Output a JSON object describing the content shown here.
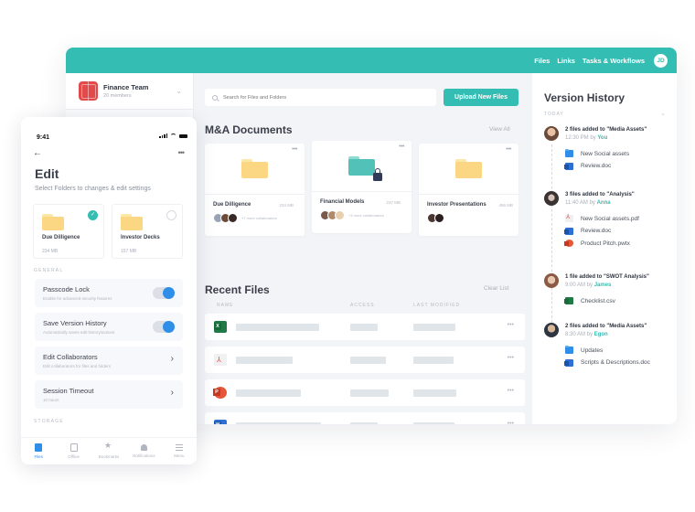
{
  "desktop": {
    "topnav": {
      "links": [
        "Files",
        "Links",
        "Tasks & Workflows"
      ],
      "user_initials": "JD"
    },
    "team": {
      "name": "Finance Team",
      "members": "20 members"
    },
    "search": {
      "placeholder": "Search for Files and Folders",
      "value": ""
    },
    "upload_button": "Upload New Files",
    "ma_documents": {
      "title": "M&A Documents",
      "view_all": "View All",
      "folders": [
        {
          "name": "Due Dilligence",
          "size": "234 MB",
          "collaborators_more": "+7 more collaborators",
          "locked": false,
          "color": "#fcd783"
        },
        {
          "name": "Financial Models",
          "size": "237 MB",
          "collaborators_more": "+4 more collaborators",
          "locked": true,
          "color": "#52c2b8"
        },
        {
          "name": "Investor Presentations",
          "size": "456 MB",
          "collaborators_more": "",
          "locked": false,
          "color": "#fcd783"
        }
      ]
    },
    "recent_files": {
      "title": "Recent Files",
      "clear_list": "Clear List",
      "columns": [
        "NAME",
        "ACCESS",
        "LAST MODIFIED"
      ],
      "rows": [
        {
          "type": "excel",
          "more": "•••"
        },
        {
          "type": "pdf",
          "more": "•••"
        },
        {
          "type": "powerpoint",
          "more": "•••"
        },
        {
          "type": "word",
          "more": "•••"
        },
        {
          "type": "pdf",
          "more": "•••"
        }
      ]
    },
    "version_history": {
      "title": "Version History",
      "group": "TODAY",
      "entries": [
        {
          "title": "2 files added to \"Media Assets\"",
          "time": "12:30 PM by ",
          "user": "You",
          "files": [
            {
              "icon": "folder",
              "name": "New Social assets"
            },
            {
              "icon": "word",
              "name": "Review.doc"
            }
          ]
        },
        {
          "title": "3 files added to \"Analysis\"",
          "time": "11:40 AM by ",
          "user": "Anna",
          "files": [
            {
              "icon": "pdf",
              "name": "New Social assets.pdf"
            },
            {
              "icon": "word",
              "name": "Review.doc"
            },
            {
              "icon": "powerpoint",
              "name": "Product Pitch.pwtx"
            }
          ]
        },
        {
          "title": "1 file added to \"SWOT Analysis\"",
          "time": "9:00 AM by ",
          "user": "James",
          "files": [
            {
              "icon": "excel",
              "name": "Checklist.csv"
            }
          ]
        },
        {
          "title": "2 files added to \"Media Assets\"",
          "time": "8:30 AM by ",
          "user": "Egon",
          "files": [
            {
              "icon": "folder",
              "name": "Updates"
            },
            {
              "icon": "word",
              "name": "Scripts & Descriptions.doc"
            }
          ]
        }
      ]
    }
  },
  "phone": {
    "status_time": "9:41",
    "title": "Edit",
    "subtitle": "Select Folders to changes & edit settings",
    "folders": [
      {
        "name": "Due Dilligence",
        "size": "234 MB",
        "selected": true
      },
      {
        "name": "Investor Decks",
        "size": "157 MB",
        "selected": false
      }
    ],
    "general_label": "GENERAL",
    "settings": [
      {
        "title": "Passcode Lock",
        "subtitle": "Enable for advanced security features",
        "control": "toggle",
        "on": true
      },
      {
        "title": "Save Version History",
        "subtitle": "Automatically saves edit history/actions",
        "control": "toggle",
        "on": true
      },
      {
        "title": "Edit Collaborators",
        "subtitle": "Edit collaborators for files and folders",
        "control": "chevron"
      },
      {
        "title": "Session Timeout",
        "subtitle": "10 hours",
        "control": "chevron"
      }
    ],
    "storage_label": "STORAGE",
    "tabs": [
      {
        "label": "Files",
        "active": true
      },
      {
        "label": "Offline",
        "active": false
      },
      {
        "label": "Bookmarks",
        "active": false
      },
      {
        "label": "Notifications",
        "active": false
      },
      {
        "label": "Menu",
        "active": false
      }
    ]
  },
  "colors": {
    "brand": "#34bdb2",
    "accent_blue": "#2f8ee8"
  }
}
